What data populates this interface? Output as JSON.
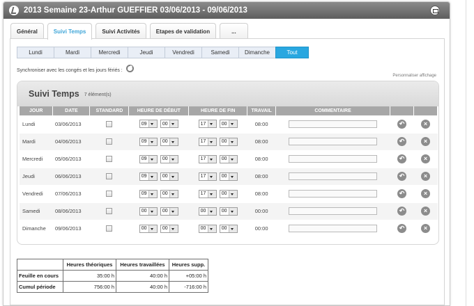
{
  "window": {
    "title": "2013 Semaine 23-Arthur GUEFFIER 03/06/2013 - 09/06/2013"
  },
  "tabs": [
    {
      "label": "Général"
    },
    {
      "label": "Suivi Temps"
    },
    {
      "label": "Suivi Activités"
    },
    {
      "label": "Etapes de validation"
    },
    {
      "label": "..."
    }
  ],
  "days": [
    "Lundi",
    "Mardi",
    "Mercredi",
    "Jeudi",
    "Vendredi",
    "Samedi",
    "Dimanche",
    "Tout"
  ],
  "sync_text": "Synchroniser avec les congés et les jours fériés :",
  "personnaliser": "Personnaliser affichage",
  "panel": {
    "title": "Suivi Temps",
    "count": "7 élément(s)"
  },
  "columns": [
    "JOUR",
    "DATE",
    "STANDARD",
    "HEURE DE DÉBUT",
    "HEURE DE FIN",
    "TRAVAIL",
    "COMMENTAIRE"
  ],
  "rows": [
    {
      "jour": "Lundi",
      "date": "03/06/2013",
      "deb_h": "09",
      "deb_m": "00",
      "fin_h": "17",
      "fin_m": "00",
      "travail": "08:00"
    },
    {
      "jour": "Mardi",
      "date": "04/06/2013",
      "deb_h": "09",
      "deb_m": "00",
      "fin_h": "17",
      "fin_m": "00",
      "travail": "08:00"
    },
    {
      "jour": "Mercredi",
      "date": "05/06/2013",
      "deb_h": "09",
      "deb_m": "00",
      "fin_h": "17",
      "fin_m": "00",
      "travail": "08:00"
    },
    {
      "jour": "Jeudi",
      "date": "06/06/2013",
      "deb_h": "09",
      "deb_m": "00",
      "fin_h": "17",
      "fin_m": "00",
      "travail": "08:00"
    },
    {
      "jour": "Vendredi",
      "date": "07/06/2013",
      "deb_h": "09",
      "deb_m": "00",
      "fin_h": "17",
      "fin_m": "00",
      "travail": "08:00"
    },
    {
      "jour": "Samedi",
      "date": "08/06/2013",
      "deb_h": "00",
      "deb_m": "00",
      "fin_h": "00",
      "fin_m": "00",
      "travail": "00:00"
    },
    {
      "jour": "Dimanche",
      "date": "09/06/2013",
      "deb_h": "00",
      "deb_m": "00",
      "fin_h": "00",
      "fin_m": "00",
      "travail": "00:00"
    }
  ],
  "totals": {
    "headers": [
      "Heures théoriques",
      "Heures travaillées",
      "Heures supp."
    ],
    "rows": [
      {
        "label": "Feuille en cours",
        "theo": "35:00 h",
        "trav": "40:00 h",
        "supp": "+05:00 h"
      },
      {
        "label": "Cumul période",
        "theo": "756:00 h",
        "trav": "40:00 h",
        "supp": "-716:00 h"
      }
    ]
  },
  "colors": {
    "accent": "#29a7e0",
    "titlebar": "#6e6e6e",
    "positive": "#2e8b2e",
    "negative": "#cc2222"
  }
}
